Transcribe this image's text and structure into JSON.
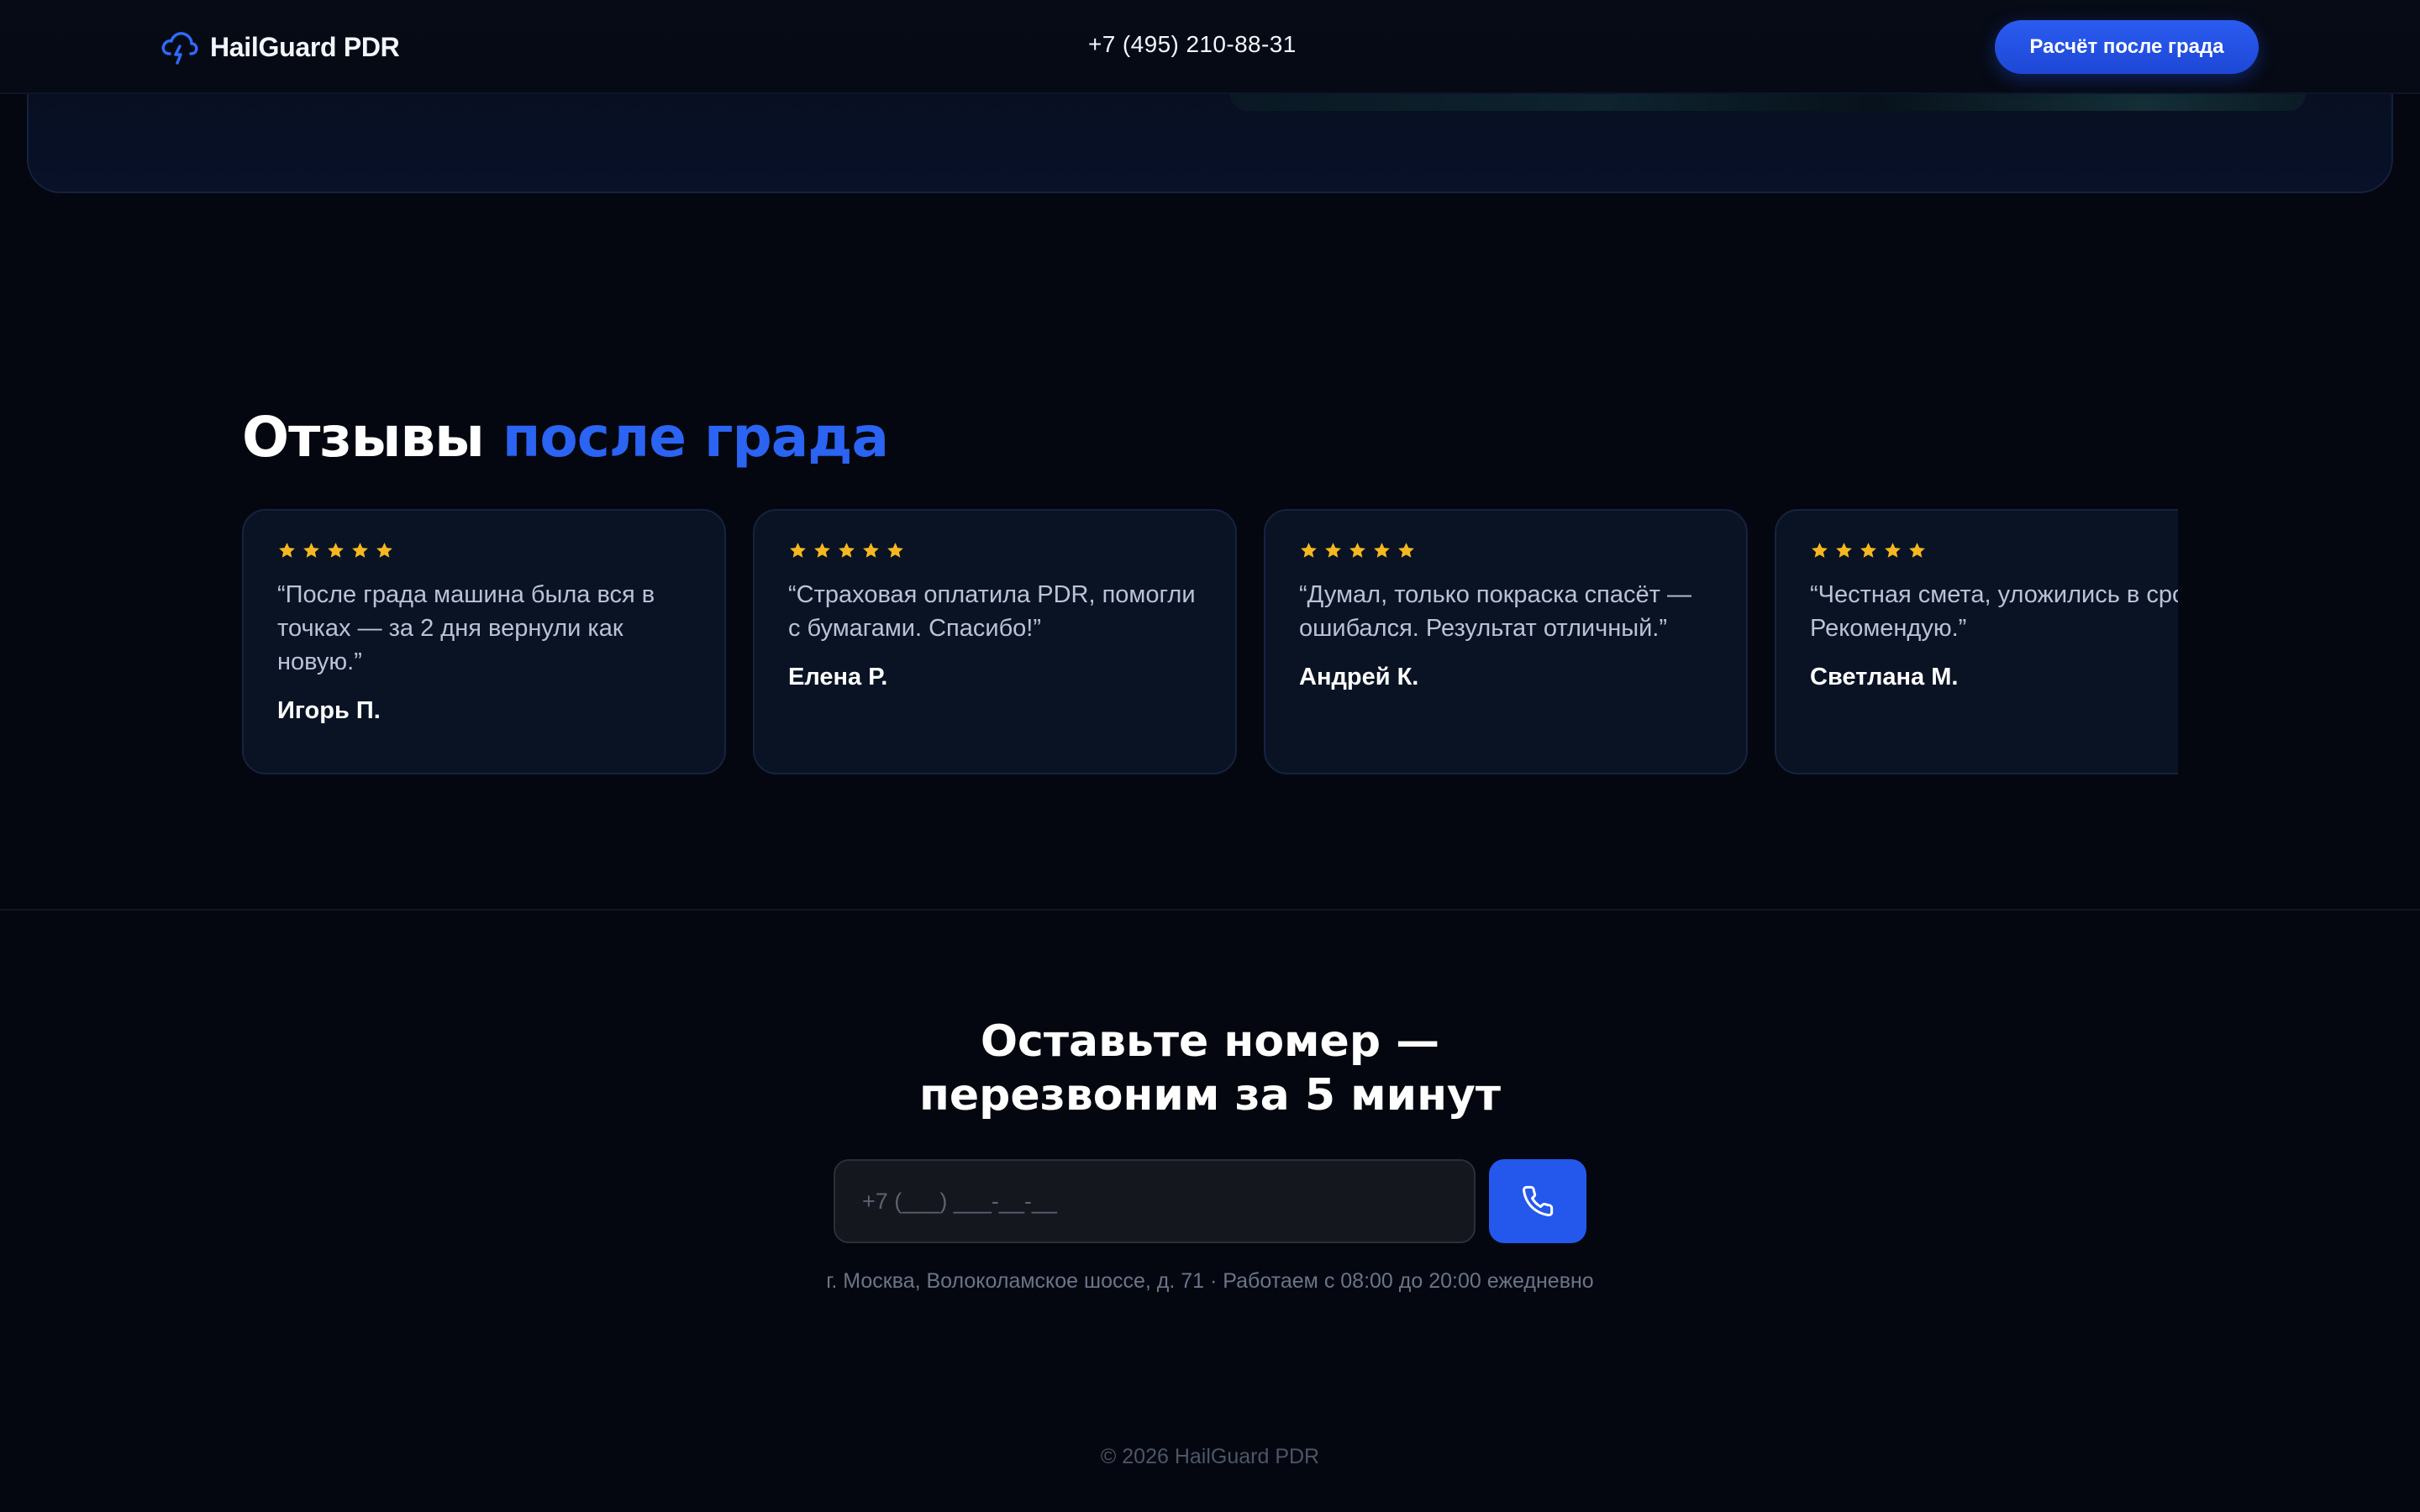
{
  "header": {
    "brand": "HailGuard PDR",
    "logo_icon": "cloud-lightning-icon",
    "phone": "+7 (495) 210-88-31",
    "cta_label": "Расчёт после града"
  },
  "reviews": {
    "title_main": "Отзывы ",
    "title_accent": "после града",
    "star_icon": "star-icon",
    "star_color": "#f6b81f",
    "items": [
      {
        "rating": 5,
        "text": "“После града машина была вся в точках — за 2 дня вернули как новую.”",
        "author": "Игорь П."
      },
      {
        "rating": 5,
        "text": "“Страховая оплатила PDR, помогли с бумагами. Спасибо!”",
        "author": "Елена Р."
      },
      {
        "rating": 5,
        "text": "“Думал, только покраска спасёт — ошибался. Результат отличный.”",
        "author": "Андрей К."
      },
      {
        "rating": 5,
        "text": "“Честная смета, уложились в срок. Рекомендую.”",
        "author": "Светлана М."
      }
    ]
  },
  "callback": {
    "title_line1": "Оставьте номер —",
    "title_line2": "перезвоним за 5 минут",
    "phone_placeholder": "+7 (___) ___-__-__",
    "button_icon": "phone-icon",
    "address": "г. Москва, Волоколамское шоссе, д. 71 · Работаем с 08:00 до 20:00 ежедневно"
  },
  "footer": {
    "copyright": "© 2026 HailGuard PDR"
  },
  "colors": {
    "accent": "#2b63f3",
    "background": "#04070f",
    "card": "#0a1324",
    "star": "#f6b81f"
  }
}
